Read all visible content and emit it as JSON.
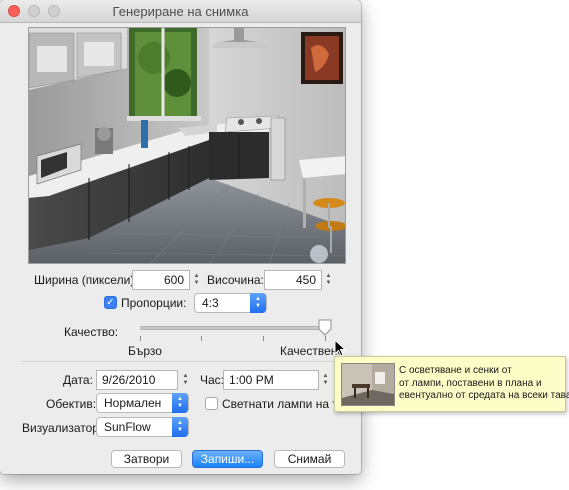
{
  "window": {
    "title": "Генериране на снимка"
  },
  "size": {
    "width_label": "Ширина (пиксели):",
    "width_value": "600",
    "height_label": "Височина:",
    "height_value": "450"
  },
  "proportions": {
    "checkbox_label": "Пропорции:",
    "checked": true,
    "ratio_value": "4:3"
  },
  "quality": {
    "label": "Качество:",
    "min_label": "Бързо",
    "max_label": "Качествено"
  },
  "date": {
    "label": "Дата:",
    "value": "9/26/2010"
  },
  "time": {
    "label": "Час:",
    "value": "1:00 PM"
  },
  "lens": {
    "label": "Обектив:",
    "value": "Нормален"
  },
  "ceiling_lights": {
    "label": "Светнати лампи на тавана",
    "checked": false
  },
  "renderer": {
    "label": "Визуализатор:",
    "value": "SunFlow"
  },
  "buttons": {
    "close": "Затвори",
    "save": "Запиши...",
    "render": "Снимай"
  },
  "tooltip": {
    "lines": [
      "С осветяване и сенки от",
      "от лампи, поставени в плана и",
      "евентуално от средата на всеки таван"
    ]
  },
  "icons": {
    "close": "window-close-icon",
    "minimize": "window-minimize-icon",
    "zoom": "window-zoom-icon",
    "checkmark": "checkmark-icon",
    "stepper": "stepper-arrows-icon",
    "popup": "popup-arrows-icon",
    "cursor": "mouse-pointer-icon"
  },
  "colors": {
    "accent": "#1a82fb",
    "tooltip_bg": "#fdfdc7",
    "close_light": "#fc5f57"
  }
}
